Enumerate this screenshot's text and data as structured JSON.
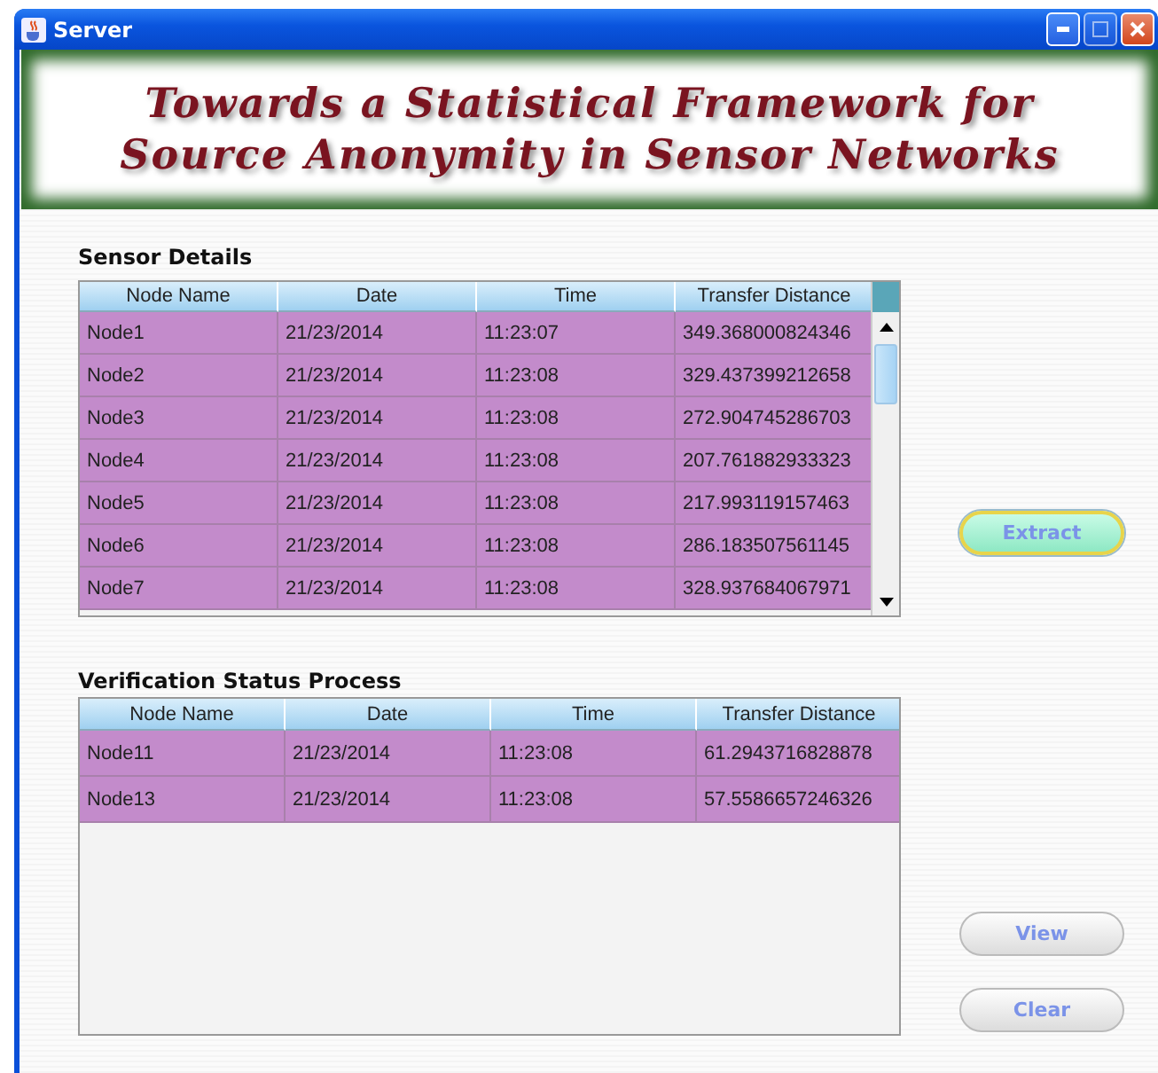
{
  "window": {
    "title": "Server"
  },
  "banner": {
    "lines": [
      "Towards a Statistical Framework for",
      "Source Anonymity in Sensor Networks"
    ]
  },
  "sensor_details": {
    "title": "Sensor Details",
    "columns": [
      "Node Name",
      "Date",
      "Time",
      "Transfer Distance"
    ],
    "rows": [
      [
        "Node1",
        "21/23/2014",
        "11:23:07",
        "349.368000824346"
      ],
      [
        "Node2",
        "21/23/2014",
        "11:23:08",
        "329.437399212658"
      ],
      [
        "Node3",
        "21/23/2014",
        "11:23:08",
        "272.904745286703"
      ],
      [
        "Node4",
        "21/23/2014",
        "11:23:08",
        "207.761882933323"
      ],
      [
        "Node5",
        "21/23/2014",
        "11:23:08",
        "217.993119157463"
      ],
      [
        "Node6",
        "21/23/2014",
        "11:23:08",
        "286.183507561145"
      ],
      [
        "Node7",
        "21/23/2014",
        "11:23:08",
        "328.937684067971"
      ]
    ]
  },
  "verification": {
    "title": "Verification Status Process",
    "columns": [
      "Node Name",
      "Date",
      "Time",
      "Transfer Distance"
    ],
    "rows": [
      [
        "Node11",
        "21/23/2014",
        "11:23:08",
        "61.2943716828878"
      ],
      [
        "Node13",
        "21/23/2014",
        "11:23:08",
        "57.5586657246326"
      ]
    ]
  },
  "buttons": [
    {
      "label": "Extract",
      "focused": true
    },
    {
      "label": "View",
      "focused": false
    },
    {
      "label": "Clear",
      "focused": false
    }
  ]
}
